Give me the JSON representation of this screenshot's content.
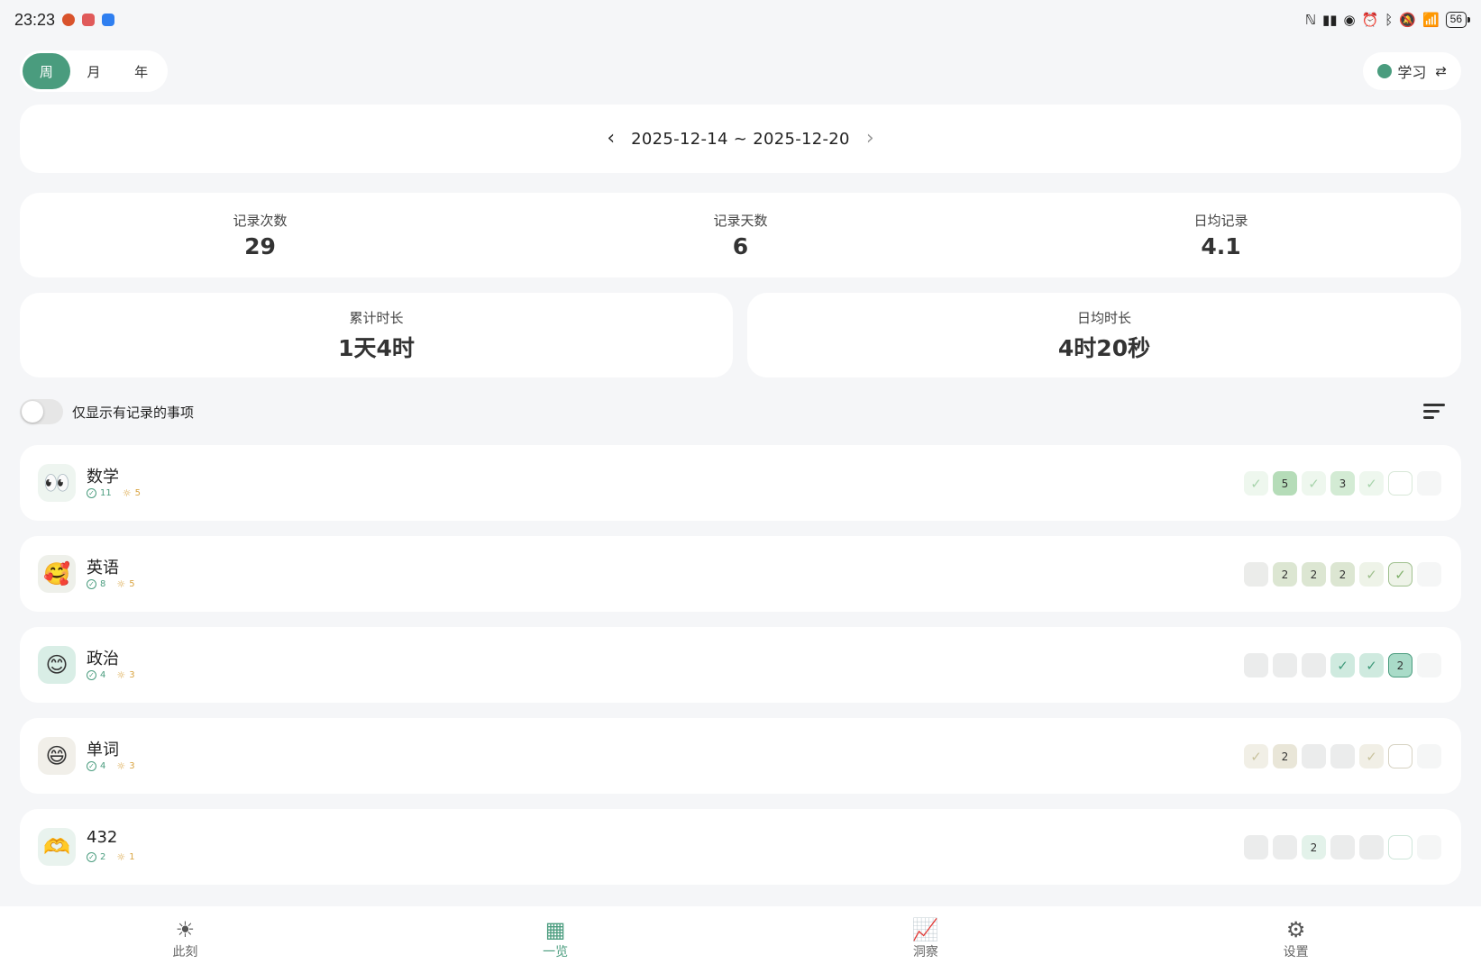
{
  "status_bar": {
    "time": "23:23",
    "app_icons": [
      "#d9532c",
      "#e05a5a",
      "#2f7ff0"
    ],
    "battery": "56"
  },
  "period_tabs": [
    {
      "label": "周",
      "active": true
    },
    {
      "label": "月",
      "active": false
    },
    {
      "label": "年",
      "active": false
    }
  ],
  "category": {
    "label": "学习",
    "color": "#4a9c7e"
  },
  "date_range": {
    "text": "2025-12-14 ~ 2025-12-20"
  },
  "stats": [
    {
      "label": "记录次数",
      "value": "29"
    },
    {
      "label": "记录天数",
      "value": "6"
    },
    {
      "label": "日均记录",
      "value": "4.1"
    }
  ],
  "durations": [
    {
      "label": "累计时长",
      "value": "1天4时"
    },
    {
      "label": "日均时长",
      "value": "4时20秒"
    }
  ],
  "filter": {
    "label": "仅显示有记录的事项",
    "enabled": false
  },
  "items": [
    {
      "title": "数学",
      "icon": "👀",
      "icon_bg": "#eef5f0",
      "checks": "11",
      "suns": "5",
      "cells": [
        {
          "text": "✓",
          "bg": "#eef7ee",
          "color": "#a8d4ac",
          "border": ""
        },
        {
          "text": "5",
          "bg": "#b5dcb8",
          "color": "#333",
          "border": ""
        },
        {
          "text": "✓",
          "bg": "#eef7ee",
          "color": "#a8d4ac",
          "border": ""
        },
        {
          "text": "3",
          "bg": "#d3ebd4",
          "color": "#333",
          "border": ""
        },
        {
          "text": "✓",
          "bg": "#eef7ee",
          "color": "#a8d4ac",
          "border": ""
        },
        {
          "text": "",
          "bg": "#ffffff",
          "color": "#333",
          "border": "#d8e8d8"
        },
        {
          "text": "",
          "bg": "#f5f6f6",
          "color": "#333",
          "border": ""
        }
      ]
    },
    {
      "title": "英语",
      "icon": "🥰",
      "icon_bg": "#eef0ea",
      "checks": "8",
      "suns": "5",
      "cells": [
        {
          "text": "",
          "bg": "#ebecea",
          "color": "#333",
          "border": ""
        },
        {
          "text": "2",
          "bg": "#dce6d2",
          "color": "#333",
          "border": ""
        },
        {
          "text": "2",
          "bg": "#dce6d2",
          "color": "#333",
          "border": ""
        },
        {
          "text": "2",
          "bg": "#dce6d2",
          "color": "#333",
          "border": ""
        },
        {
          "text": "✓",
          "bg": "#eef3e8",
          "color": "#9fc08e",
          "border": ""
        },
        {
          "text": "✓",
          "bg": "#eef3e8",
          "color": "#7fb06a",
          "border": "#9fc08e"
        },
        {
          "text": "",
          "bg": "#f5f6f6",
          "color": "#333",
          "border": ""
        }
      ]
    },
    {
      "title": "政治",
      "icon": "😊",
      "icon_bg": "#d9eee6",
      "checks": "4",
      "suns": "3",
      "cells": [
        {
          "text": "",
          "bg": "#ebecec",
          "color": "#333",
          "border": ""
        },
        {
          "text": "",
          "bg": "#ebecec",
          "color": "#333",
          "border": ""
        },
        {
          "text": "",
          "bg": "#ebecec",
          "color": "#333",
          "border": ""
        },
        {
          "text": "✓",
          "bg": "#cfeadf",
          "color": "#3f9a7a",
          "border": ""
        },
        {
          "text": "✓",
          "bg": "#cfeadf",
          "color": "#3f9a7a",
          "border": ""
        },
        {
          "text": "2",
          "bg": "#a9dbc8",
          "color": "#333",
          "border": "#4a9c7e"
        },
        {
          "text": "",
          "bg": "#f5f6f6",
          "color": "#333",
          "border": ""
        }
      ]
    },
    {
      "title": "单词",
      "icon": "😄",
      "icon_bg": "#f1efe9",
      "checks": "4",
      "suns": "3",
      "cells": [
        {
          "text": "✓",
          "bg": "#f1efe6",
          "color": "#c9c39e",
          "border": ""
        },
        {
          "text": "2",
          "bg": "#e9e6d8",
          "color": "#333",
          "border": ""
        },
        {
          "text": "",
          "bg": "#ebecec",
          "color": "#333",
          "border": ""
        },
        {
          "text": "",
          "bg": "#ebecec",
          "color": "#333",
          "border": ""
        },
        {
          "text": "✓",
          "bg": "#f1efe6",
          "color": "#c9c39e",
          "border": ""
        },
        {
          "text": "",
          "bg": "#ffffff",
          "color": "#333",
          "border": "#d6d2c2"
        },
        {
          "text": "",
          "bg": "#f5f6f6",
          "color": "#333",
          "border": ""
        }
      ]
    },
    {
      "title": "432",
      "icon": "🫶",
      "icon_bg": "#e9f3ee",
      "checks": "2",
      "suns": "1",
      "cells": [
        {
          "text": "",
          "bg": "#ebecec",
          "color": "#333",
          "border": ""
        },
        {
          "text": "",
          "bg": "#ebecec",
          "color": "#333",
          "border": ""
        },
        {
          "text": "2",
          "bg": "#e3f2ea",
          "color": "#333",
          "border": ""
        },
        {
          "text": "",
          "bg": "#ebecec",
          "color": "#333",
          "border": ""
        },
        {
          "text": "",
          "bg": "#ebecec",
          "color": "#333",
          "border": ""
        },
        {
          "text": "",
          "bg": "#ffffff",
          "color": "#333",
          "border": "#cfe6da"
        },
        {
          "text": "",
          "bg": "#f5f6f6",
          "color": "#333",
          "border": ""
        }
      ]
    }
  ],
  "nav": [
    {
      "label": "此刻",
      "icon": "sun-icon",
      "glyph": "☀",
      "active": false
    },
    {
      "label": "一览",
      "icon": "dashboard-icon",
      "glyph": "▦",
      "active": true
    },
    {
      "label": "洞察",
      "icon": "trend-icon",
      "glyph": "📈",
      "active": false
    },
    {
      "label": "设置",
      "icon": "gear-icon",
      "glyph": "⚙",
      "active": false
    }
  ]
}
